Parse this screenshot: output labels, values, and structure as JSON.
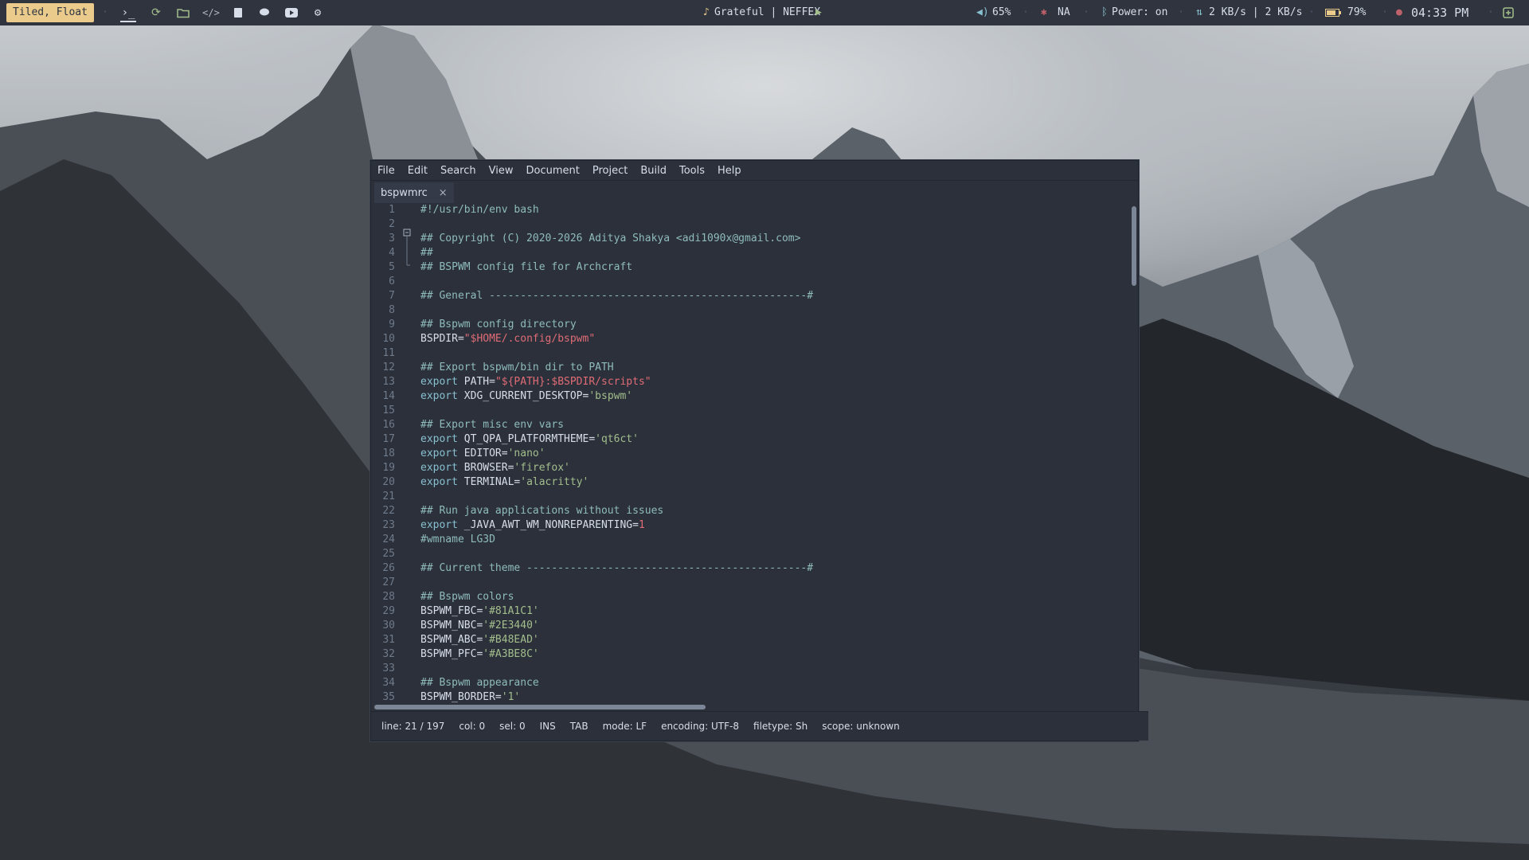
{
  "topbar": {
    "mode": "Tiled, Float",
    "icons": [
      "terminal-icon",
      "refresh-icon",
      "folder-icon",
      "code-icon",
      "book-icon",
      "chat-icon",
      "youtube-icon",
      "gear-icon"
    ],
    "music": "Grateful | NEFFEX",
    "volume": "65%",
    "network": "NA",
    "bluetooth": "Power: on",
    "speed": "2 KB/s | 2 KB/s",
    "battery": "79%",
    "clock": "04:33 PM",
    "accent": "#ebcb8b"
  },
  "window": {
    "menu": [
      "File",
      "Edit",
      "Search",
      "View",
      "Document",
      "Project",
      "Build",
      "Tools",
      "Help"
    ],
    "tab_label": "bspwmrc",
    "tab_close": "×",
    "status": {
      "line": "line: 21 / 197",
      "col": "col: 0",
      "sel": "sel: 0",
      "ins": "INS",
      "tab": "TAB",
      "mode": "mode: LF",
      "encoding": "encoding: UTF-8",
      "filetype": "filetype: Sh",
      "scope": "scope: unknown"
    }
  },
  "code_lines": [
    [
      {
        "t": "#!/usr/bin/env bash",
        "c": "c-comment"
      }
    ],
    [],
    [
      {
        "t": "## Copyright (C) 2020-2026 Aditya Shakya <adi1090x@gmail.com>",
        "c": "c-comment"
      }
    ],
    [
      {
        "t": "##",
        "c": "c-comment"
      }
    ],
    [
      {
        "t": "## BSPWM config file for Archcraft",
        "c": "c-comment"
      }
    ],
    [],
    [
      {
        "t": "## General ---------------------------------------------------#",
        "c": "c-comment"
      }
    ],
    [],
    [
      {
        "t": "## Bspwm config directory",
        "c": "c-comment"
      }
    ],
    [
      {
        "t": "BSPDIR=",
        "c": ""
      },
      {
        "t": "\"$HOME/.config/bspwm\"",
        "c": "c-str2"
      }
    ],
    [],
    [
      {
        "t": "## Export bspwm/bin dir to PATH",
        "c": "c-comment"
      }
    ],
    [
      {
        "t": "export",
        "c": "c-kw"
      },
      {
        "t": " PATH=",
        "c": ""
      },
      {
        "t": "\"${PATH}:$BSPDIR/scripts\"",
        "c": "c-str2"
      }
    ],
    [
      {
        "t": "export",
        "c": "c-kw"
      },
      {
        "t": " XDG_CURRENT_DESKTOP=",
        "c": ""
      },
      {
        "t": "'bspwm'",
        "c": "c-str"
      }
    ],
    [],
    [
      {
        "t": "## Export misc env vars",
        "c": "c-comment"
      }
    ],
    [
      {
        "t": "export",
        "c": "c-kw"
      },
      {
        "t": " QT_QPA_PLATFORMTHEME=",
        "c": ""
      },
      {
        "t": "'qt6ct'",
        "c": "c-str"
      }
    ],
    [
      {
        "t": "export",
        "c": "c-kw"
      },
      {
        "t": " EDITOR=",
        "c": ""
      },
      {
        "t": "'nano'",
        "c": "c-str"
      }
    ],
    [
      {
        "t": "export",
        "c": "c-kw"
      },
      {
        "t": " BROWSER=",
        "c": ""
      },
      {
        "t": "'firefox'",
        "c": "c-str"
      }
    ],
    [
      {
        "t": "export",
        "c": "c-kw"
      },
      {
        "t": " TERMINAL=",
        "c": ""
      },
      {
        "t": "'alacritty'",
        "c": "c-str"
      }
    ],
    [],
    [
      {
        "t": "## Run java applications without issues",
        "c": "c-comment"
      }
    ],
    [
      {
        "t": "export",
        "c": "c-kw"
      },
      {
        "t": " _JAVA_AWT_WM_NONREPARENTING=",
        "c": ""
      },
      {
        "t": "1",
        "c": "c-str2"
      }
    ],
    [
      {
        "t": "#wmname LG3D",
        "c": "c-comment"
      }
    ],
    [],
    [
      {
        "t": "## Current theme ---------------------------------------------#",
        "c": "c-comment"
      }
    ],
    [],
    [
      {
        "t": "## Bspwm colors",
        "c": "c-comment"
      }
    ],
    [
      {
        "t": "BSPWM_FBC=",
        "c": ""
      },
      {
        "t": "'#81A1C1'",
        "c": "c-str"
      }
    ],
    [
      {
        "t": "BSPWM_NBC=",
        "c": ""
      },
      {
        "t": "'#2E3440'",
        "c": "c-str"
      }
    ],
    [
      {
        "t": "BSPWM_ABC=",
        "c": ""
      },
      {
        "t": "'#B48EAD'",
        "c": "c-str"
      }
    ],
    [
      {
        "t": "BSPWM_PFC=",
        "c": ""
      },
      {
        "t": "'#A3BE8C'",
        "c": "c-str"
      }
    ],
    [],
    [
      {
        "t": "## Bspwm appearance",
        "c": "c-comment"
      }
    ],
    [
      {
        "t": "BSPWM_BORDER=",
        "c": ""
      },
      {
        "t": "'1'",
        "c": "c-str"
      }
    ]
  ]
}
